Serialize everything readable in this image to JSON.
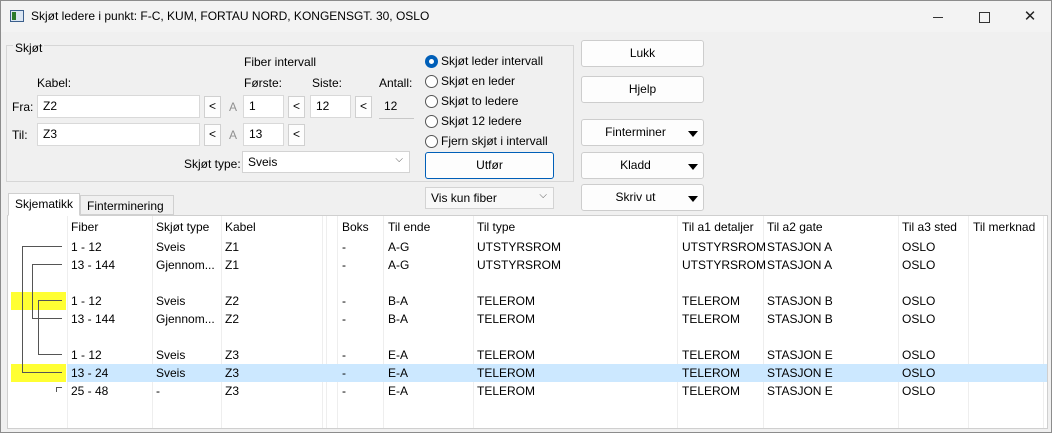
{
  "window": {
    "title": "Skjøt ledere i punkt: F-C, KUM, FORTAU NORD, KONGENSGT. 30, OSLO",
    "close_glyph": "✕"
  },
  "form": {
    "group_label": "Skjøt",
    "kabel_label": "Kabel:",
    "fiber_interval_label": "Fiber intervall",
    "forste_label": "Første:",
    "siste_label": "Siste:",
    "antall_label": "Antall:",
    "fra_label": "Fra:",
    "til_label": "Til:",
    "fra_cable": "Z2",
    "til_cable": "Z3",
    "fra_forste": "1",
    "fra_siste": "12",
    "fra_antall": "12",
    "til_forste": "13",
    "lt": "<",
    "a": "A",
    "skjot_type_label": "Skjøt type:",
    "skjot_type_value": "Sveis",
    "vis_fiber_value": "Vis kun fiber"
  },
  "radios": [
    {
      "label": "Skjøt leder intervall",
      "checked": true
    },
    {
      "label": "Skjøt en leder",
      "checked": false
    },
    {
      "label": "Skjøt to ledere",
      "checked": false
    },
    {
      "label": "Skjøt 12 ledere",
      "checked": false
    },
    {
      "label": "Fjern skjøt i intervall",
      "checked": false
    }
  ],
  "buttons": {
    "utfor": "Utfør",
    "lukk": "Lukk",
    "hjelp": "Hjelp",
    "finterminer": "Finterminer",
    "kladd": "Kladd",
    "skriv_ut": "Skriv ut"
  },
  "tabs": [
    "Skjematikk",
    "Finterminering"
  ],
  "grid": {
    "headers": [
      "Fiber",
      "Skjøt type",
      "Kabel",
      "Boks",
      "Til ende",
      "Til type",
      "Til a1 detaljer",
      "Til a2 gate",
      "Til a3 sted",
      "Til merknad"
    ],
    "rows": [
      [
        "1 - 12",
        "Sveis",
        "Z1",
        "-",
        "A-G",
        "UTSTYRSROM",
        "UTSTYRSROM",
        "STASJON A",
        "OSLO",
        ""
      ],
      [
        "13 - 144",
        "Gjennom...",
        "Z1",
        "-",
        "A-G",
        "UTSTYRSROM",
        "UTSTYRSROM",
        "STASJON A",
        "OSLO",
        ""
      ],
      [
        "1 - 12",
        "Sveis",
        "Z2",
        "-",
        "B-A",
        "TELEROM",
        "TELEROM",
        "STASJON B",
        "OSLO",
        ""
      ],
      [
        "13 - 144",
        "Gjennom...",
        "Z2",
        "-",
        "B-A",
        "TELEROM",
        "TELEROM",
        "STASJON B",
        "OSLO",
        ""
      ],
      [
        "1 - 12",
        "Sveis",
        "Z3",
        "-",
        "E-A",
        "TELEROM",
        "TELEROM",
        "STASJON E",
        "OSLO",
        ""
      ],
      [
        "13 - 24",
        "Sveis",
        "Z3",
        "-",
        "E-A",
        "TELEROM",
        "TELEROM",
        "STASJON E",
        "OSLO",
        ""
      ],
      [
        "25 - 48",
        "-",
        "Z3",
        "-",
        "E-A",
        "TELEROM",
        "TELEROM",
        "STASJON E",
        "OSLO",
        ""
      ]
    ],
    "selected_row": 5,
    "highlighted_rows": [
      2,
      5
    ],
    "highlight_color": "#ffff33",
    "selection_color": "#cce8ff"
  }
}
